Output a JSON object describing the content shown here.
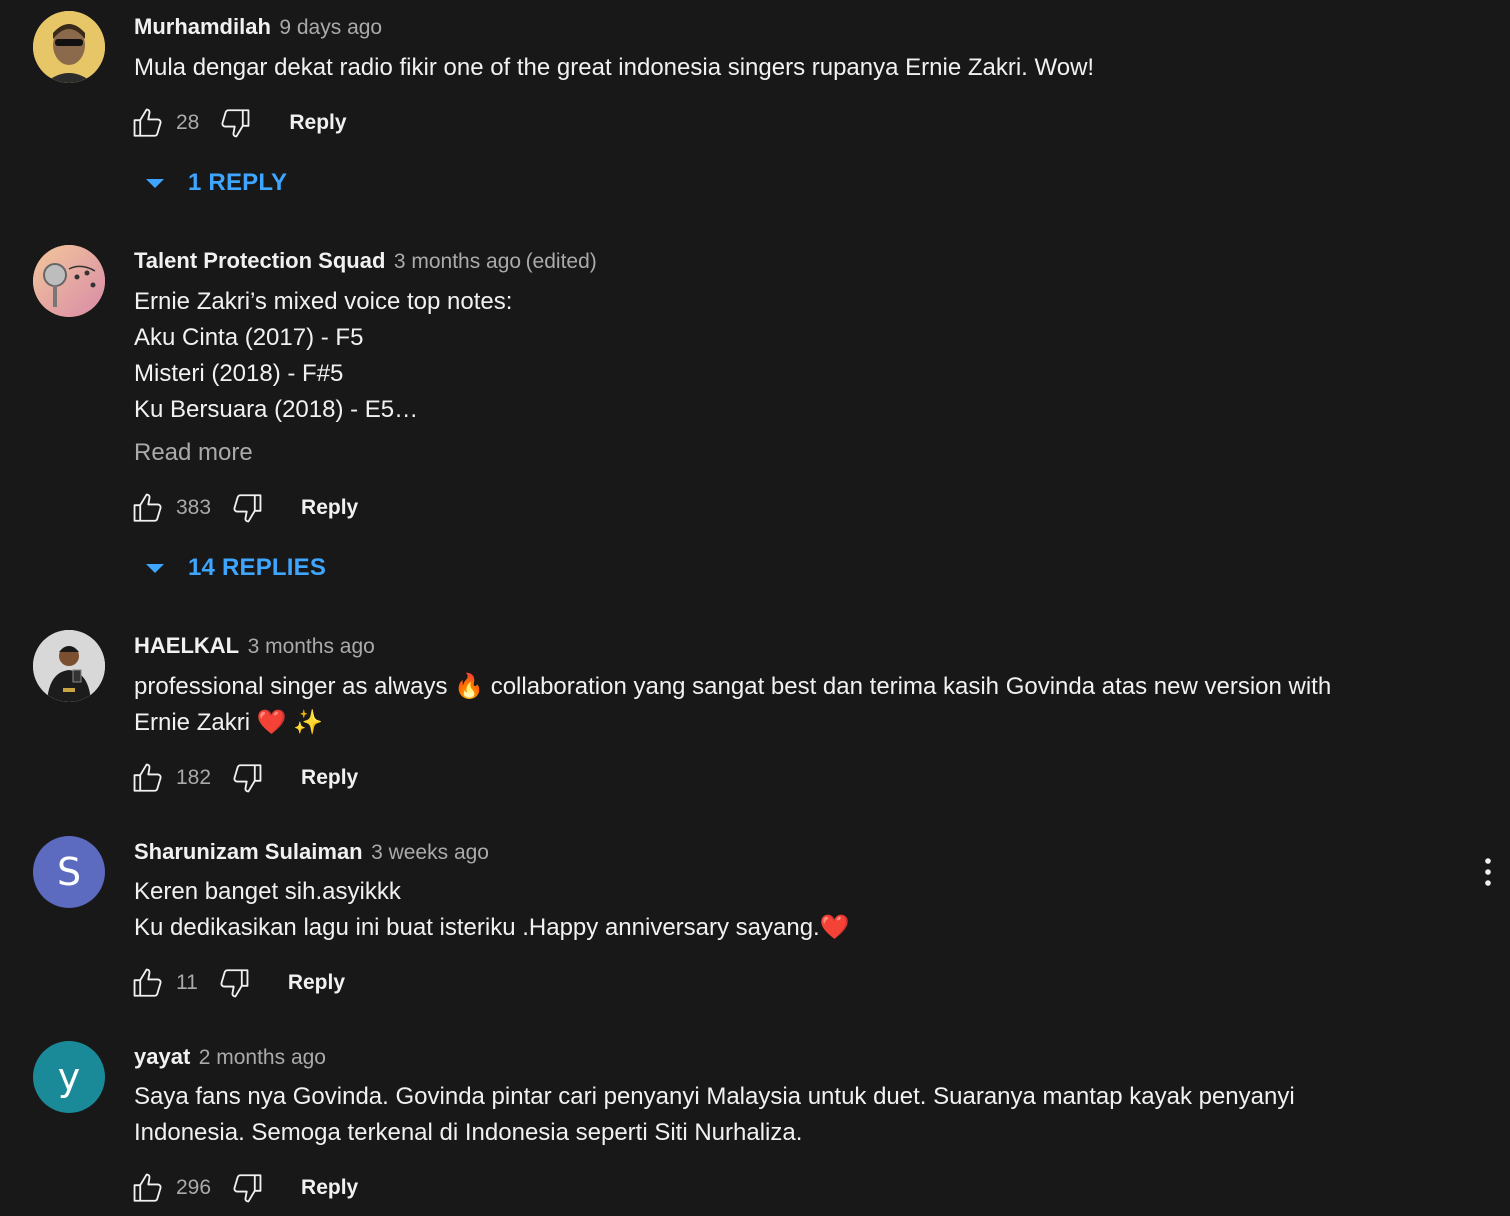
{
  "comments": [
    {
      "author": "Murhamdilah",
      "time": "9 days ago",
      "edited": "",
      "lines": [
        "Mula dengar dekat radio fikir one of the great indonesia singers rupanya Ernie Zakri. Wow!"
      ],
      "likes": "28",
      "reply_label": "Reply",
      "replies_label": "1 REPLY",
      "avatar": {
        "type": "photo",
        "color": "#e7c667"
      }
    },
    {
      "author": "Talent Protection Squad",
      "time": "3 months ago",
      "edited": "(edited)",
      "lines": [
        "Ernie Zakri’s mixed voice top notes:",
        "Aku Cinta (2017) - F5",
        "Misteri (2018) - F#5",
        "Ku Bersuara (2018) - E5…"
      ],
      "read_more": "Read more",
      "likes": "383",
      "reply_label": "Reply",
      "replies_label": "14 REPLIES",
      "avatar": {
        "type": "photo",
        "color": "#e9a38a"
      }
    },
    {
      "author": "HAELKAL",
      "time": "3 months ago",
      "edited": "",
      "lines": [
        "professional singer as always 🔥 collaboration yang sangat best dan terima kasih Govinda atas new version with",
        "Ernie Zakri ❤️ ✨"
      ],
      "likes": "182",
      "reply_label": "Reply",
      "avatar": {
        "type": "photo",
        "color": "#e0e0e0"
      }
    },
    {
      "author": "Sharunizam Sulaiman",
      "time": "3 weeks ago",
      "edited": "",
      "lines": [
        "Keren banget sih.asyikkk",
        "Ku dedikasikan lagu ini buat isteriku .Happy anniversary sayang.❤️"
      ],
      "likes": "11",
      "reply_label": "Reply",
      "avatar": {
        "type": "letter",
        "letter": "S",
        "color": "#5c6bc0"
      }
    },
    {
      "author": "yayat",
      "time": "2 months ago",
      "edited": "",
      "lines": [
        "Saya fans nya Govinda. Govinda pintar cari penyanyi Malaysia untuk duet. Suaranya mantap kayak penyanyi",
        "Indonesia. Semoga terkenal di Indonesia seperti Siti Nurhaliza."
      ],
      "likes": "296",
      "reply_label": "Reply",
      "avatar": {
        "type": "letter",
        "letter": "y",
        "color": "#1a8a98"
      }
    }
  ],
  "colors": {
    "background": "#181818",
    "text_primary": "#f1f1f1",
    "text_secondary": "#aaaaaa",
    "link_blue": "#3ea6ff"
  },
  "icons": [
    "thumbs-up-icon",
    "thumbs-down-icon",
    "caret-down-icon",
    "more-vert-icon"
  ]
}
